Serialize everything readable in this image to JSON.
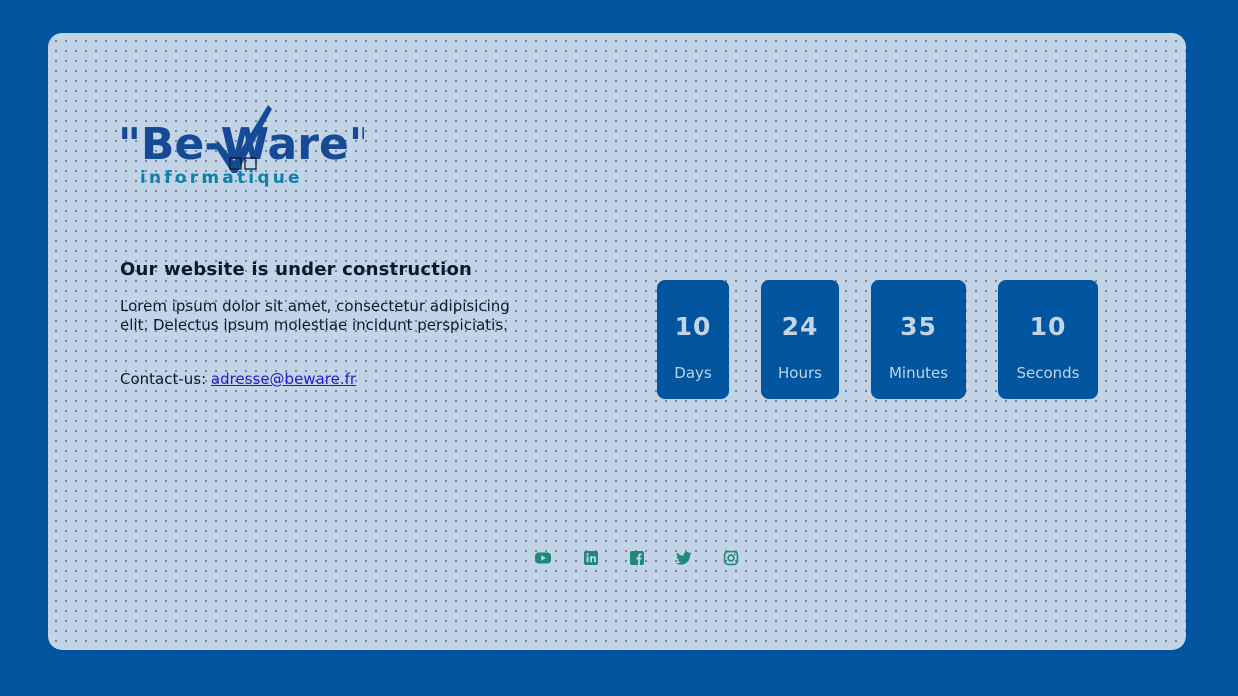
{
  "brand": {
    "logo_main": "\"Be-Ware\"",
    "logo_sub": "informatique",
    "primary_color": "#00559e",
    "logo_blue": "#174a96",
    "logo_teal": "#0e82a8",
    "icon_color": "#1f8a7a"
  },
  "main": {
    "headline": "Our website is under construction",
    "description": "Lorem ipsum dolor sit amet, consectetur adipisicing elit. Delectus ipsum molestiae incidunt perspiciatis.",
    "contact_label": "Contact-us: ",
    "contact_email": "adresse@beware.fr"
  },
  "countdown": [
    {
      "value": "10",
      "label": "Days"
    },
    {
      "value": "24",
      "label": "Hours"
    },
    {
      "value": "35",
      "label": "Minutes"
    },
    {
      "value": "10",
      "label": "Seconds"
    }
  ],
  "social": [
    {
      "icon": "youtube-icon"
    },
    {
      "icon": "linkedin-icon"
    },
    {
      "icon": "facebook-icon"
    },
    {
      "icon": "twitter-icon"
    },
    {
      "icon": "instagram-icon"
    }
  ]
}
